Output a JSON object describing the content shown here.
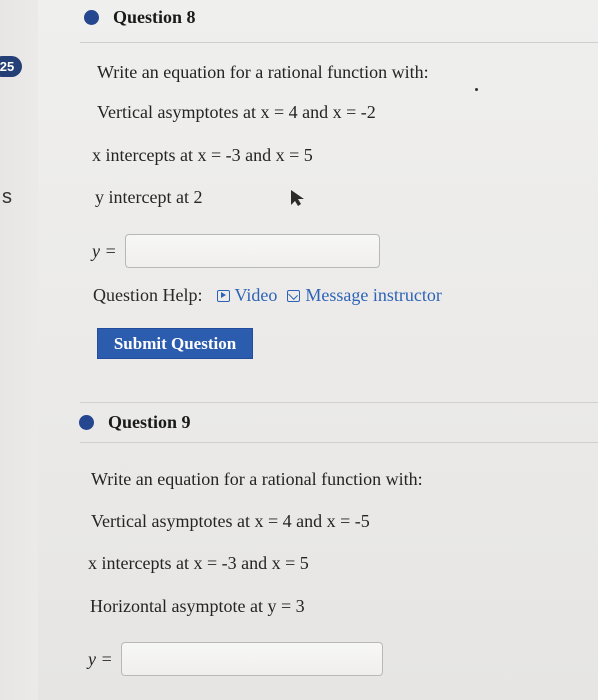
{
  "side": {
    "badge": "25",
    "letter": "s"
  },
  "question8": {
    "title": "Question 8",
    "prompt": "Write an equation for a rational function with:",
    "line1": "Vertical asymptotes at x = 4 and x = -2",
    "line2": "x intercepts at x = -3 and x = 5",
    "line3": "y intercept at 2",
    "answer_label": "y =",
    "help_label": "Question Help:",
    "video_label": "Video",
    "message_label": "Message instructor",
    "submit_label": "Submit Question"
  },
  "question9": {
    "title": "Question 9",
    "prompt": "Write an equation for a rational function with:",
    "line1": "Vertical asymptotes at x = 4 and x = -5",
    "line2": "x intercepts at x = -3 and x = 5",
    "line3": "Horizontal asymptote at y = 3",
    "answer_label": "y ="
  },
  "colors": {
    "accent": "#2c5cae",
    "dot": "#25478f",
    "badge": "#243f76",
    "link": "#2d63b6"
  },
  "icons": {
    "bullet": "dot-icon",
    "video": "video-icon",
    "message": "mail-icon",
    "cursor": "cursor-icon"
  }
}
